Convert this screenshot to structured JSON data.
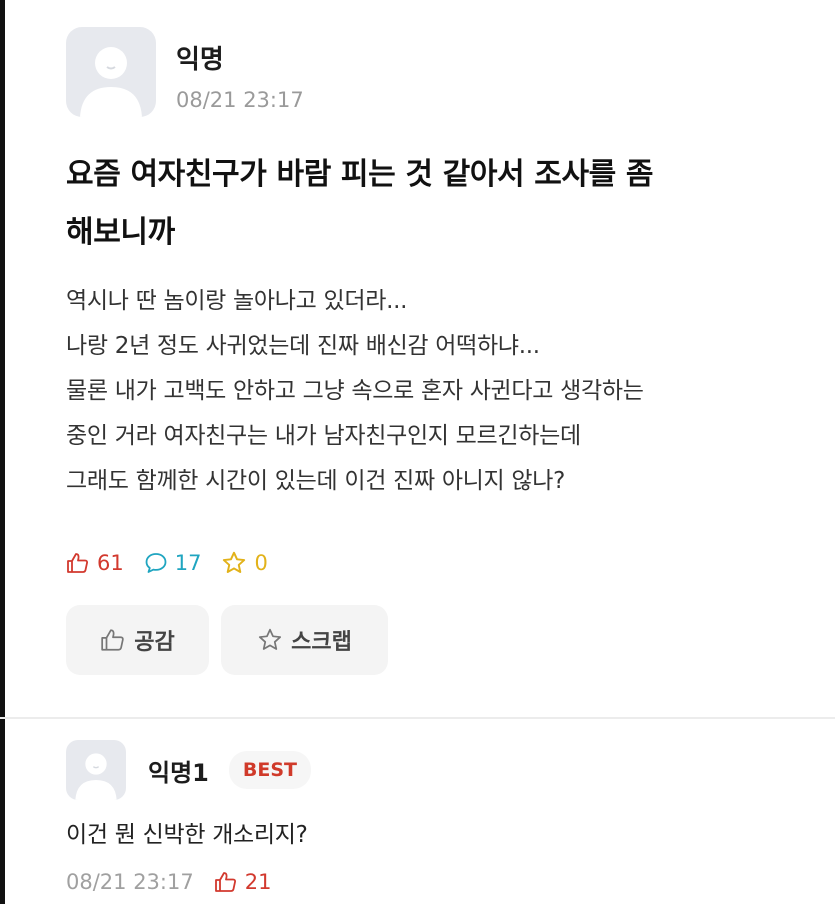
{
  "post": {
    "author": "익명",
    "date": "08/21 23:17",
    "title_lines": [
      "요즘 여자친구가 바람 피는 것 같아서 조사를 좀",
      "해보니까"
    ],
    "body_lines": [
      "역시나 딴 놈이랑 놀아나고 있더라...",
      "나랑 2년 정도 사귀었는데 진짜 배신감 어떡하냐...",
      "물론 내가 고백도 안하고 그냥 속으로 혼자 사귄다고 생각하는",
      "중인 거라 여자친구는 내가 남자친구인지 모르긴하는데",
      "그래도 함께한 시간이 있는데 이건 진짜 아니지 않나?"
    ],
    "stats": {
      "likes": "61",
      "comments": "17",
      "scraps": "0"
    },
    "buttons": {
      "like_label": "공감",
      "scrap_label": "스크랩"
    }
  },
  "comment": {
    "author": "익명1",
    "badge": "BEST",
    "text": "이건 뭔 신박한 개소리지?",
    "date": "08/21 23:17",
    "likes": "21"
  },
  "icons": {
    "like": "thumbs-up-icon",
    "comment": "speech-bubble-icon",
    "scrap": "star-icon",
    "avatar": "anonymous-user-icon"
  },
  "colors": {
    "like": "#d2392e",
    "comment": "#1fa5c0",
    "scrap": "#e2b21a",
    "best_badge": "#d03a2a"
  }
}
